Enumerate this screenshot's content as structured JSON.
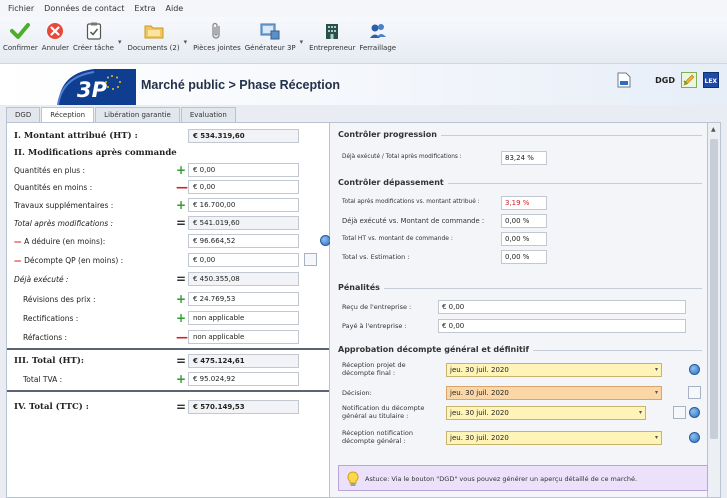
{
  "menu": [
    "Fichier",
    "Données de contact",
    "Extra",
    "Aide"
  ],
  "toolbar": {
    "confirm": "Confirmer",
    "cancel": "Annuler",
    "create_task": "Créer tâche",
    "documents": "Documents (2)",
    "attachments": "Pièces jointes",
    "generator": "Générateur 3P",
    "contractor": "Entrepreneur",
    "ferraillage": "Ferraillage"
  },
  "header": {
    "logo_text": "3P",
    "title": "Marché public  >  Phase Réception",
    "dgd_label": "DGD",
    "lex_label": "LEX"
  },
  "tabs": [
    "DGD",
    "Réception",
    "Libération garantie",
    "Evaluation"
  ],
  "left": {
    "montant_attribue": {
      "label": "I. Montant attribué (HT) :",
      "value": "€ 534.319,60"
    },
    "modifications_head": "II. Modifications après commande",
    "quantites_plus": {
      "label": "Quantités en plus :",
      "value": "€ 0,00"
    },
    "quantites_moins": {
      "label": "Quantités en moins :",
      "value": "€ 0,00"
    },
    "travaux_supp": {
      "label": "Travaux supplémentaires :",
      "value": "€ 16.700,00"
    },
    "total_apres_modif": {
      "label": "Total après modifications :",
      "value": "€ 541.019,60"
    },
    "a_deduire": {
      "label": "A déduire (en moins):",
      "value": "€ 96.664,52"
    },
    "decompte_qp": {
      "label": "Décompte QP (en moins) :",
      "value": "€ 0,00"
    },
    "deja_execute": {
      "label": "Déjà exécuté :",
      "value": "€ 450.355,08"
    },
    "revisions_prix": {
      "label": "Révisions des prix :",
      "value": "€ 24.769,53"
    },
    "rectifications": {
      "label": "Rectifications :",
      "value": "non applicable"
    },
    "refactions": {
      "label": "Réfactions :",
      "value": "non applicable"
    },
    "total_ht": {
      "label": "III. Total (HT):",
      "value": "€ 475.124,61"
    },
    "total_tva": {
      "label": "Total TVA :",
      "value": "€ 95.024,92"
    },
    "total_ttc": {
      "label": "IV. Total (TTC) :",
      "value": "€ 570.149,53"
    }
  },
  "right": {
    "progression": {
      "title": "Contrôler progression",
      "deja_total": {
        "label": "Déjà exécuté / Total après modifications :",
        "value": "83,24 %"
      }
    },
    "depassement": {
      "title": "Contrôler dépassement",
      "total_vs_montant": {
        "label": "Total après modifications vs. montant attribué :",
        "value": "3,19 %"
      },
      "deja_vs_commande": {
        "label": "Déjà exécuté vs. Montant de commande :",
        "value": "0,00 %"
      },
      "total_ht_vs_commande": {
        "label": "Total HT vs. montant de commande :",
        "value": "0,00 %"
      },
      "total_vs_estimation": {
        "label": "Total vs. Estimation :",
        "value": "0,00 %"
      }
    },
    "penalites": {
      "title": "Pénalités",
      "recu": {
        "label": "Reçu de l'entreprise :",
        "value": "€ 0,00"
      },
      "paye": {
        "label": "Payé à l'entreprise :",
        "value": "€ 0,00"
      }
    },
    "approbation": {
      "title": "Approbation décompte général et définitif",
      "reception_projet": {
        "label1": "Réception projet de",
        "label2": "décompte final :",
        "value": "jeu. 30 juil. 2020"
      },
      "decision": {
        "label": "Décision:",
        "value": "jeu. 30 juil. 2020"
      },
      "notification": {
        "label1": "Notification du décompte",
        "label2": "général au titulaire :",
        "value": "jeu. 30 juil. 2020"
      },
      "reception_notif": {
        "label1": "Réception notification",
        "label2": "décompte général :",
        "value": "jeu. 30 juil. 2020"
      }
    }
  },
  "tip": "Astuce: Via le bouton \"DGD\" vous pouvez générer un aperçu détaillé de ce marché."
}
